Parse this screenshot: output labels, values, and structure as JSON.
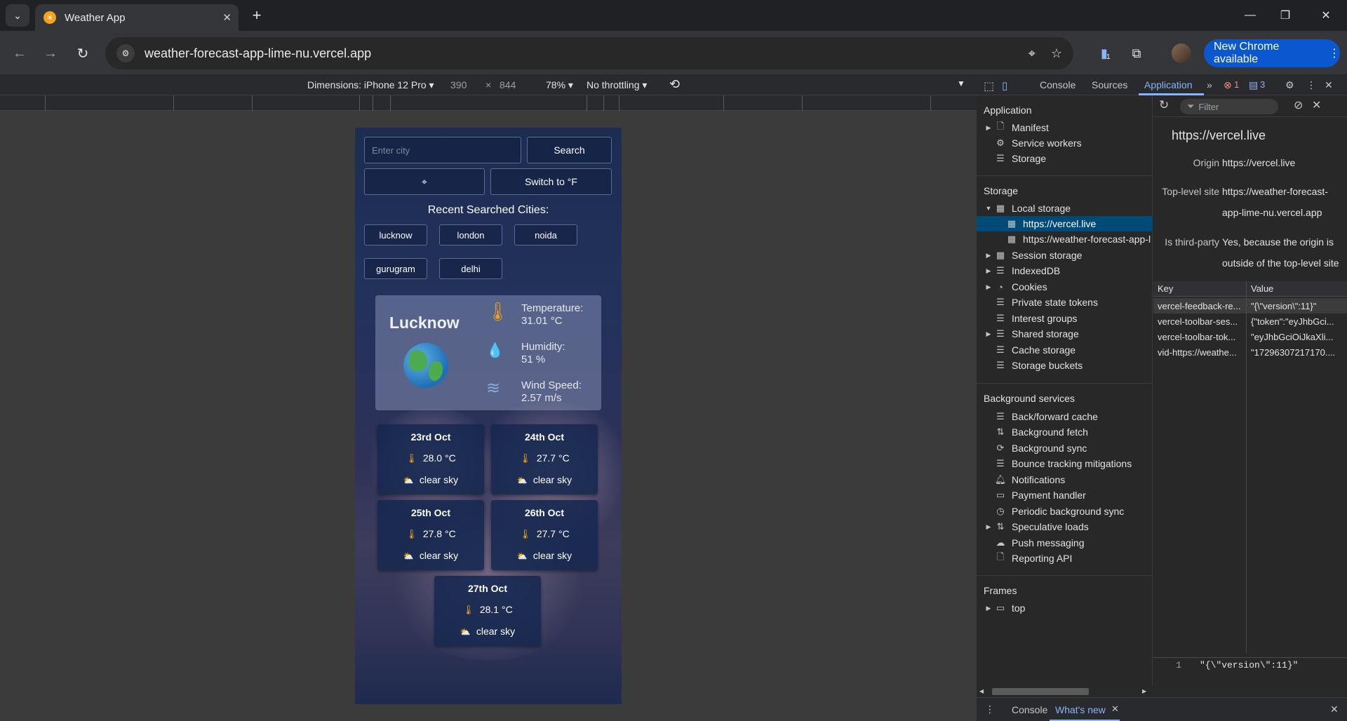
{
  "browser": {
    "tab_title": "Weather App",
    "url": "weather-forecast-app-lime-nu.vercel.app",
    "update_label": "New Chrome available",
    "extension_badge": "1"
  },
  "device_toolbar": {
    "device": "Dimensions: iPhone 12 Pro",
    "width": "390",
    "times": "×",
    "height": "844",
    "zoom": "78%",
    "throttling": "No throttling"
  },
  "app": {
    "city_placeholder": "Enter city",
    "search_label": "Search",
    "locate_icon": "⌖",
    "switch_label": "Switch to °F",
    "recent_title": "Recent Searched Cities:",
    "recent": [
      "lucknow",
      "london",
      "noida",
      "gurugram",
      "delhi"
    ],
    "current": {
      "city": "Lucknow",
      "temp_label": "Temperature:",
      "temp_value": "31.01 °C",
      "hum_label": "Humidity:",
      "hum_value": "51 %",
      "wind_label": "Wind Speed:",
      "wind_value": "2.57 m/s"
    },
    "forecast": [
      {
        "date": "23rd Oct",
        "temp": "28.0 °C",
        "desc": "clear sky"
      },
      {
        "date": "24th Oct",
        "temp": "27.7 °C",
        "desc": "clear sky"
      },
      {
        "date": "25th Oct",
        "temp": "27.8 °C",
        "desc": "clear sky"
      },
      {
        "date": "26th Oct",
        "temp": "27.7 °C",
        "desc": "clear sky"
      },
      {
        "date": "27th Oct",
        "temp": "28.1 °C",
        "desc": "clear sky"
      }
    ]
  },
  "devtools": {
    "tabs": {
      "console": "Console",
      "sources": "Sources",
      "application": "Application"
    },
    "errors": "1",
    "messages": "3",
    "sidebar": {
      "application_title": "Application",
      "manifest": "Manifest",
      "service_workers": "Service workers",
      "storage": "Storage",
      "storage_title": "Storage",
      "local_storage": "Local storage",
      "ls_item1": "https://vercel.live",
      "ls_item2": "https://weather-forecast-app-l",
      "session_storage": "Session storage",
      "indexeddb": "IndexedDB",
      "cookies": "Cookies",
      "private_state": "Private state tokens",
      "interest_groups": "Interest groups",
      "shared_storage": "Shared storage",
      "cache_storage": "Cache storage",
      "storage_buckets": "Storage buckets",
      "bg_title": "Background services",
      "bfcache": "Back/forward cache",
      "bg_fetch": "Background fetch",
      "bg_sync": "Background sync",
      "bounce": "Bounce tracking mitigations",
      "notifications": "Notifications",
      "payment": "Payment handler",
      "periodic": "Periodic background sync",
      "speculative": "Speculative loads",
      "push": "Push messaging",
      "reporting": "Reporting API",
      "frames_title": "Frames",
      "top": "top"
    },
    "main": {
      "filter": "Filter",
      "origin_title": "https://vercel.live",
      "origin_key": "Origin",
      "origin_val": "https://vercel.live",
      "top_key": "Top-level site",
      "top_val1": "https://weather-forecast-",
      "top_val2": "app-lime-nu.vercel.app",
      "third_key": "Is third-party",
      "third_val1": "Yes, because the origin is",
      "third_val2": "outside of the top-level site",
      "col_key": "Key",
      "col_value": "Value",
      "rows": [
        {
          "k": "vercel-feedback-re...",
          "v": "\"{\\\"version\\\":11}\""
        },
        {
          "k": "vercel-toolbar-ses...",
          "v": "{\"token\":\"eyJhbGci..."
        },
        {
          "k": "vercel-toolbar-tok...",
          "v": "\"eyJhbGciOiJkaXli..."
        },
        {
          "k": "vid-https://weathe...",
          "v": "\"17296307217170...."
        }
      ],
      "preview_line": "1",
      "preview_value": "\"{\\\"version\\\":11}\""
    },
    "drawer": {
      "console": "Console",
      "whats_new": "What's new"
    }
  }
}
